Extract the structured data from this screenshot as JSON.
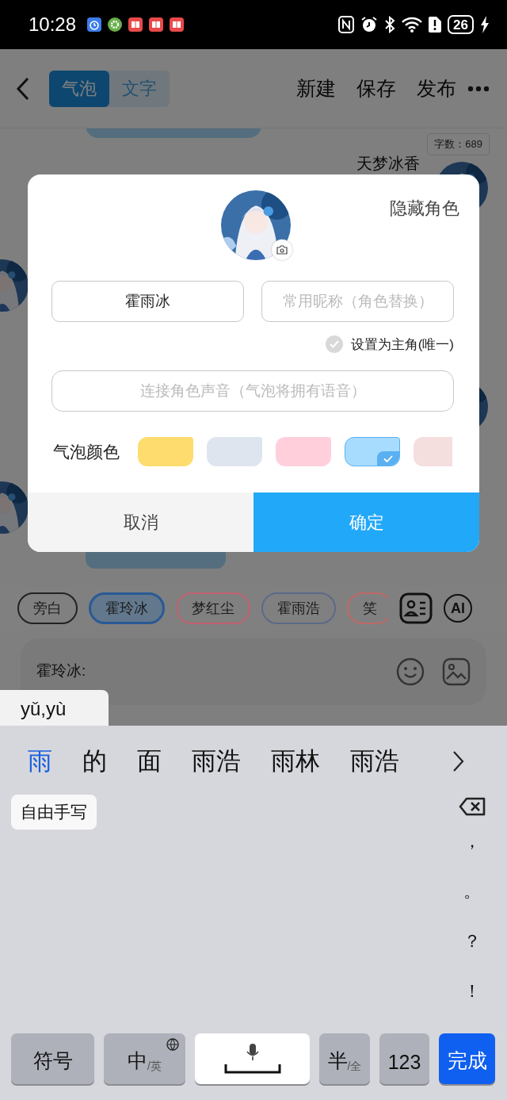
{
  "status_bar": {
    "time": "10:28",
    "battery": "26"
  },
  "header": {
    "tabs": [
      {
        "label": "气泡",
        "selected": true
      },
      {
        "label": "文字",
        "selected": false
      }
    ],
    "actions": [
      "新建",
      "保存",
      "发布"
    ]
  },
  "chat": {
    "word_count": "字数：689",
    "speaker": "天梦冰香"
  },
  "characters": [
    {
      "name": "旁白",
      "color": "#222222",
      "selected": false
    },
    {
      "name": "霍玲冰",
      "color": "#2a5a95",
      "selected": true
    },
    {
      "name": "梦红尘",
      "color": "#c06070",
      "selected": false
    },
    {
      "name": "霍雨浩",
      "color": "#5a6a88",
      "selected": false
    },
    {
      "name": "笑",
      "color": "#c06868",
      "selected": false
    }
  ],
  "ai_button": "AI",
  "composer": {
    "prefix": "霍玲冰:"
  },
  "dialog": {
    "hide_label": "隐藏角色",
    "name_field": {
      "value": "霍雨冰"
    },
    "nickname_field": {
      "placeholder": "常用昵称（角色替换）"
    },
    "main_role": {
      "label": "设置为主角(唯一)",
      "checked": false
    },
    "voice_field": {
      "placeholder": "连接角色声音（气泡将拥有语音）"
    },
    "bubble_color": {
      "label": "气泡颜色",
      "swatches": [
        {
          "color": "#ffdc6e",
          "selected": false
        },
        {
          "color": "#dfe5ee",
          "selected": false
        },
        {
          "color": "#ffd0dc",
          "selected": false
        },
        {
          "color": "#a8dcff",
          "selected": true
        },
        {
          "color": "#f5dede",
          "selected": false
        }
      ]
    },
    "buttons": [
      {
        "label": "取消",
        "kind": "cancel"
      },
      {
        "label": "确定",
        "kind": "confirm"
      }
    ]
  },
  "ime": {
    "pinyin": "yǔ,yù",
    "candidates": [
      {
        "text": "雨",
        "selected": true
      },
      {
        "text": "的",
        "selected": false
      },
      {
        "text": "面",
        "selected": false
      },
      {
        "text": "雨浩",
        "selected": false
      },
      {
        "text": "雨林",
        "selected": false
      },
      {
        "text": "雨浩",
        "selected": false
      }
    ],
    "handwriting": "自由手写",
    "punctuation": [
      "，",
      "。",
      "？",
      "！"
    ],
    "keys": [
      {
        "label": "符号",
        "kind": "plain"
      },
      {
        "label": "中",
        "sub": "/英",
        "kind": "lang"
      },
      {
        "kind": "space"
      },
      {
        "label": "半",
        "sub": "/全",
        "kind": "plain"
      },
      {
        "label": "123",
        "kind": "plain"
      },
      {
        "label": "完成",
        "kind": "done"
      }
    ]
  }
}
